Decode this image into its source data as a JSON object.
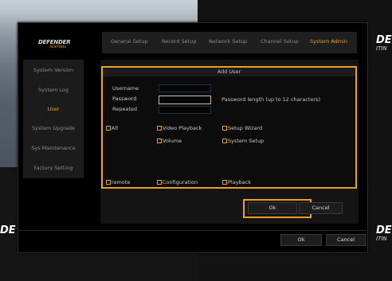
{
  "background": {
    "side_brand_left": "DE",
    "side_brand_right": "DE",
    "side_sub_right": "ITIN"
  },
  "header": {
    "logo_main": "DEFENDER",
    "logo_sub": "SENTINEL",
    "tabs": [
      {
        "label": "General Setup",
        "active": false
      },
      {
        "label": "Record Setup",
        "active": false
      },
      {
        "label": "Network Setup",
        "active": false
      },
      {
        "label": "Channel Setup",
        "active": false
      },
      {
        "label": "System Admin",
        "active": true
      }
    ]
  },
  "sidebar": {
    "items": [
      {
        "label": "System Version",
        "active": false
      },
      {
        "label": "System Log",
        "active": false
      },
      {
        "label": "User",
        "active": true
      },
      {
        "label": "System Upgrade",
        "active": false
      },
      {
        "label": "Sys Maintenance",
        "active": false
      },
      {
        "label": "Factory Setting",
        "active": false
      }
    ]
  },
  "add_user": {
    "title": "Add User",
    "username_label": "Username",
    "password_label": "Password",
    "repeated_label": "Repeated",
    "username_value": "",
    "password_value": "",
    "repeated_value": "",
    "password_hint": "Password length (up to 12 characters)",
    "permissions": {
      "all": "All",
      "video_playback": "Video Playback",
      "setup_wizard": "Setup Wizard",
      "volume": "Volume",
      "system_setup": "System Setup",
      "remote": "remote",
      "configuration": "Configuration",
      "playback": "Playback"
    },
    "ok_label": "Ok",
    "cancel_label": "Cancel"
  },
  "footer": {
    "ok_label": "Ok",
    "cancel_label": "Cancel"
  },
  "colors": {
    "accent": "#e8a020",
    "panel": "#000000",
    "text": "#c8c8c8"
  }
}
